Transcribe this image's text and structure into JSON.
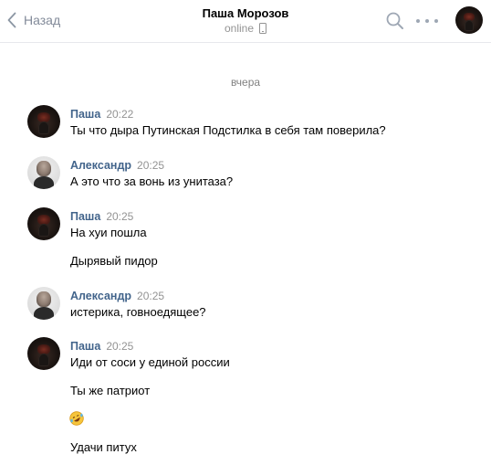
{
  "header": {
    "back_label": "Назад",
    "title": "Паша Морозов",
    "status": "online"
  },
  "day_divider": "вчера",
  "messages": [
    {
      "author": "Паша",
      "time": "20:22",
      "lines": [
        "Ты что дыра Путинская Подстилка в себя там поверила?"
      ]
    },
    {
      "author": "Александр",
      "time": "20:25",
      "lines": [
        "А это что за вонь из унитаза?"
      ]
    },
    {
      "author": "Паша",
      "time": "20:25",
      "lines": [
        "На хуи пошла",
        "Дырявый пидор"
      ]
    },
    {
      "author": "Александр",
      "time": "20:25",
      "lines": [
        "истерика, говноедящее?"
      ]
    },
    {
      "author": "Паша",
      "time": "20:25",
      "lines": [
        "Иди от соси у единой россии",
        "Ты же патриот",
        "Удачи питух"
      ],
      "emoji": "rofl-emoji"
    }
  ],
  "colors": {
    "author": "#42648b",
    "muted": "#939393",
    "divider": "#e7e8ec"
  }
}
